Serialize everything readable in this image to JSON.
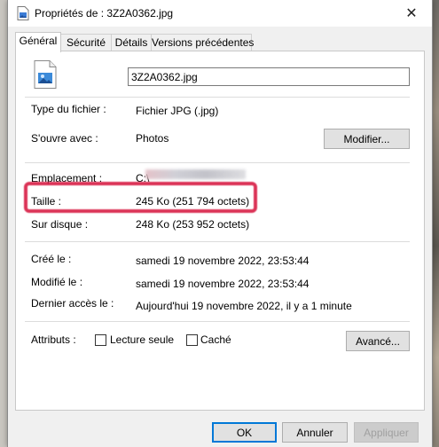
{
  "window": {
    "title": "Propriétés de : 3Z2A0362.jpg"
  },
  "tabs": [
    {
      "label": "Général",
      "active": true
    },
    {
      "label": "Sécurité"
    },
    {
      "label": "Détails"
    },
    {
      "label": "Versions précédentes"
    }
  ],
  "general": {
    "file_name": "3Z2A0362.jpg",
    "type_label": "Type du fichier :",
    "type_value": "Fichier JPG (.jpg)",
    "opens_label": "S'ouvre avec :",
    "opens_value": "Photos",
    "modify_button": "Modifier...",
    "location_label": "Emplacement :",
    "location_value": "C:\\",
    "size_label": "Taille :",
    "size_value": "245 Ko (251 794 octets)",
    "disk_label": "Sur disque :",
    "disk_value": "248 Ko (253 952 octets)",
    "created_label": "Créé le :",
    "created_value": "samedi 19 novembre 2022, 23:53:44",
    "modified_label": "Modifié le :",
    "modified_value": "samedi 19 novembre 2022, 23:53:44",
    "accessed_label": "Dernier accès le :",
    "accessed_value": "Aujourd'hui 19 novembre 2022, il y a 1 minute",
    "attributes_label": "Attributs :",
    "readonly_label": "Lecture seule",
    "hidden_label": "Caché",
    "advanced_button": "Avancé..."
  },
  "footer": {
    "ok": "OK",
    "cancel": "Annuler",
    "apply": "Appliquer"
  },
  "colors": {
    "highlight": "#d81e45",
    "accent": "#0078d7"
  }
}
